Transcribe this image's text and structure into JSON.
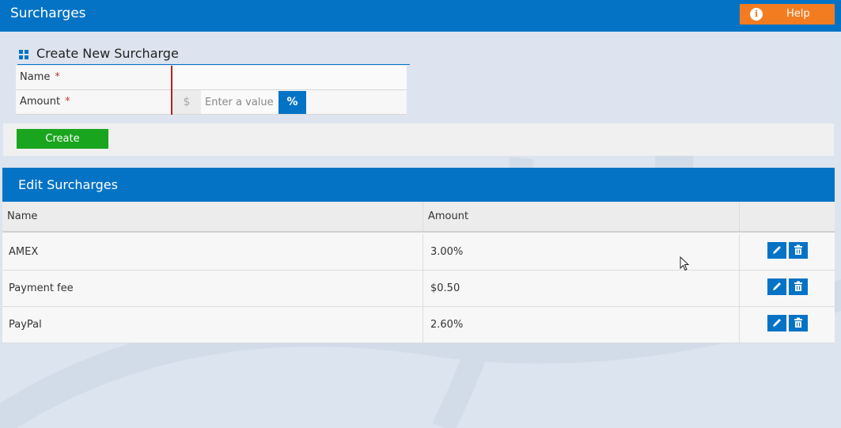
{
  "header": {
    "title": "Surcharges",
    "help_label": "Help",
    "help_icon": "info-icon"
  },
  "create_form": {
    "title": "Create New Surcharge",
    "name_label": "Name",
    "amount_label": "Amount",
    "required_marker": "*",
    "currency_symbol": "$",
    "amount_placeholder": "Enter a value",
    "percent_toggle": "%",
    "create_label": "Create"
  },
  "edit_section": {
    "title": "Edit Surcharges",
    "columns": [
      "Name",
      "Amount"
    ],
    "rows": [
      {
        "name": "AMEX",
        "amount": "3.00%"
      },
      {
        "name": "Payment fee",
        "amount": "$0.50"
      },
      {
        "name": "PayPal",
        "amount": "2.60%"
      }
    ]
  },
  "colors": {
    "primary": "#0473c6",
    "help": "#f47c20",
    "create": "#1aa51f",
    "required_divider": "#b22222"
  }
}
